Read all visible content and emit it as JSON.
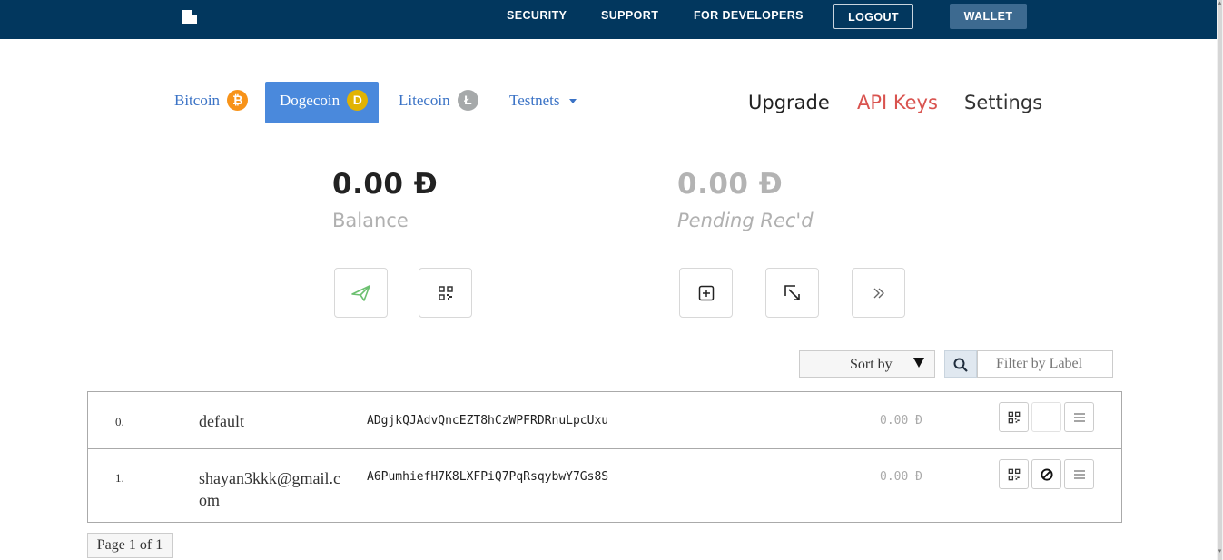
{
  "nav": {
    "security": "SECURITY",
    "support": "SUPPORT",
    "developers": "FOR DEVELOPERS",
    "logout": "LOGOUT",
    "wallet": "WALLET"
  },
  "coins": {
    "bitcoin": {
      "label": "Bitcoin",
      "symbol": "₿",
      "color": "#f7931a"
    },
    "dogecoin": {
      "label": "Dogecoin",
      "symbol": "D",
      "color": "#e1b303"
    },
    "litecoin": {
      "label": "Litecoin",
      "symbol": "Ł",
      "color": "#a6a9aa"
    },
    "testnets": {
      "label": "Testnets"
    }
  },
  "account_links": {
    "upgrade": "Upgrade",
    "api_keys": "API Keys",
    "settings": "Settings"
  },
  "balances": {
    "balance": {
      "amount": "0.00 Đ",
      "label": "Balance"
    },
    "pending": {
      "amount": "0.00 Đ",
      "label": "Pending Rec'd"
    }
  },
  "actions": {
    "left": [
      "send-icon",
      "qr-code-icon"
    ],
    "right": [
      "add-address-icon",
      "receive-icon",
      "double-chevron-right-icon"
    ]
  },
  "filters": {
    "sort_label": "Sort by",
    "filter_placeholder": "Filter by Label"
  },
  "addresses": [
    {
      "index": "0.",
      "label": "default",
      "address": "ADgjkQJAdvQncEZT8hCzWPFRDRnuLpcUxu",
      "balance": "0.00 Đ"
    },
    {
      "index": "1.",
      "label": "shayan3kkk@gmail.com",
      "address": "A6PumhiefH7K8LXFPiQ7PqRsqybwY7Gs8S",
      "balance": "0.00 Đ"
    }
  ],
  "pagination": {
    "text": "Page 1 of 1"
  },
  "colors": {
    "navbar": "#02375e",
    "accent": "#4a89dc",
    "link": "#3b73c6",
    "api_keys": "#d9534f",
    "send_green": "#6cc070"
  }
}
